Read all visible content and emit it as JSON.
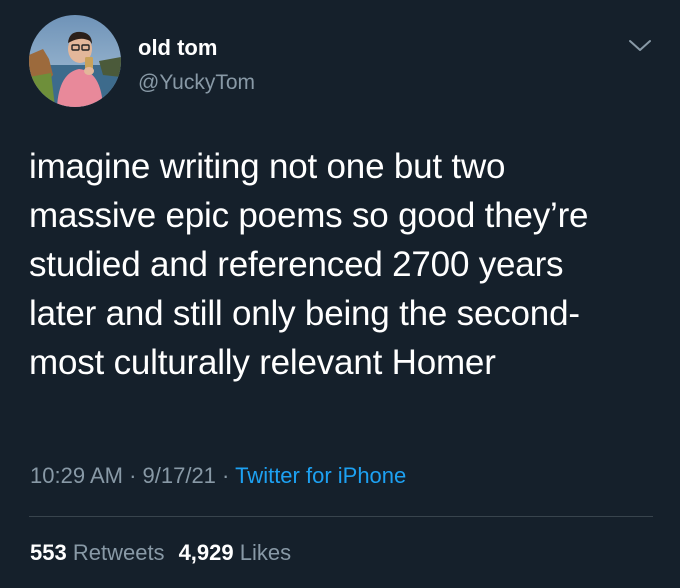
{
  "user": {
    "display_name": "old tom",
    "handle": "@YuckyTom"
  },
  "tweet": {
    "lines": [
      "imagine writing not one but two",
      "massive epic poems so good they’re",
      "studied and referenced 2700 years",
      "later and still only being the second-",
      "most culturally relevant Homer"
    ],
    "time": "10:29 AM",
    "separator": " · ",
    "date": "9/17/21",
    "source": "Twitter for iPhone"
  },
  "stats": {
    "retweets_count": "553",
    "retweets_label": "Retweets",
    "likes_count": "4,929",
    "likes_label": "Likes"
  },
  "icons": {
    "menu": "chevron-down-icon",
    "avatar": "profile-photo"
  },
  "colors": {
    "background": "#15202b",
    "primary_text": "#ffffff",
    "secondary_text": "#8899a6",
    "link": "#1da1f2",
    "divider": "#38444d"
  }
}
